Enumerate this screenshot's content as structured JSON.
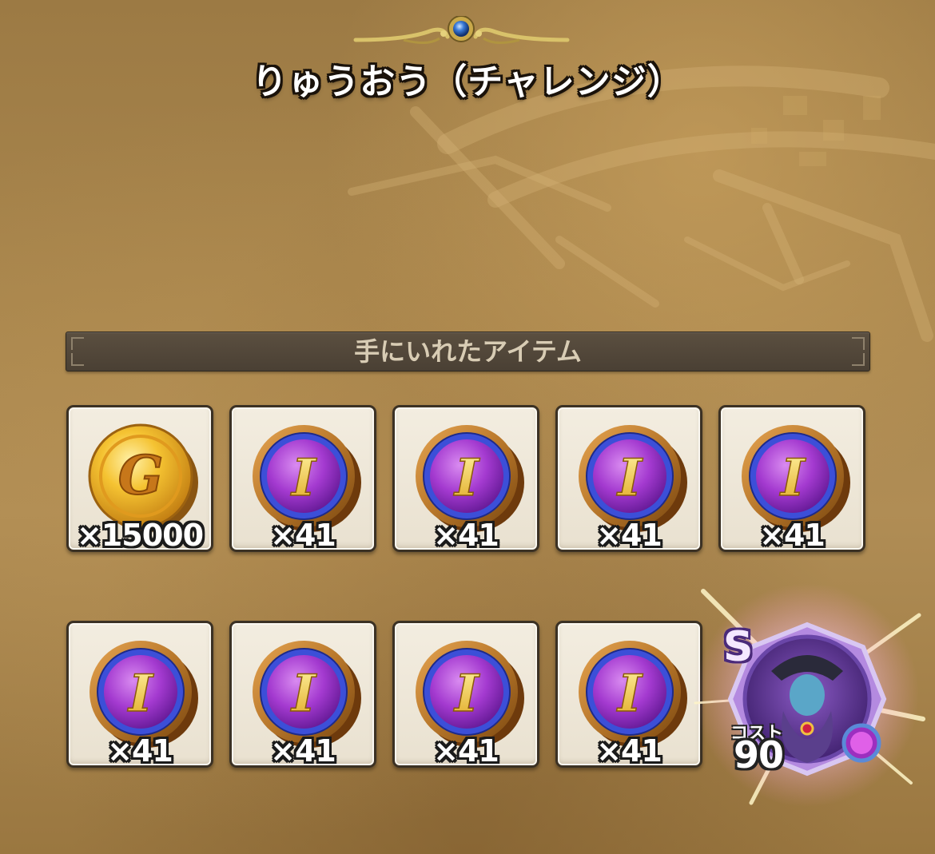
{
  "title": "りゅうおう（チャレンジ）",
  "section": {
    "label": "手にいれたアイテム"
  },
  "items": [
    {
      "icon": "gold-coin-icon",
      "glyph": "G",
      "quantity": "×15000"
    },
    {
      "icon": "item-coin-icon",
      "glyph": "I",
      "quantity": "×41"
    },
    {
      "icon": "item-coin-icon",
      "glyph": "I",
      "quantity": "×41"
    },
    {
      "icon": "item-coin-icon",
      "glyph": "I",
      "quantity": "×41"
    },
    {
      "icon": "item-coin-icon",
      "glyph": "I",
      "quantity": "×41"
    },
    {
      "icon": "item-coin-icon",
      "glyph": "I",
      "quantity": "×41"
    },
    {
      "icon": "item-coin-icon",
      "glyph": "I",
      "quantity": "×41"
    },
    {
      "icon": "item-coin-icon",
      "glyph": "I",
      "quantity": "×41"
    },
    {
      "icon": "item-coin-icon",
      "glyph": "I",
      "quantity": "×41"
    }
  ],
  "medal": {
    "icon": "monster-medal-icon",
    "rank": "S",
    "cost_label": "コスト",
    "cost": "90"
  },
  "colors": {
    "gold": "#f0b020",
    "purple": "#a43ad0",
    "ring_blue": "#3c4fd8",
    "rim_bronze": "#b8772a"
  }
}
